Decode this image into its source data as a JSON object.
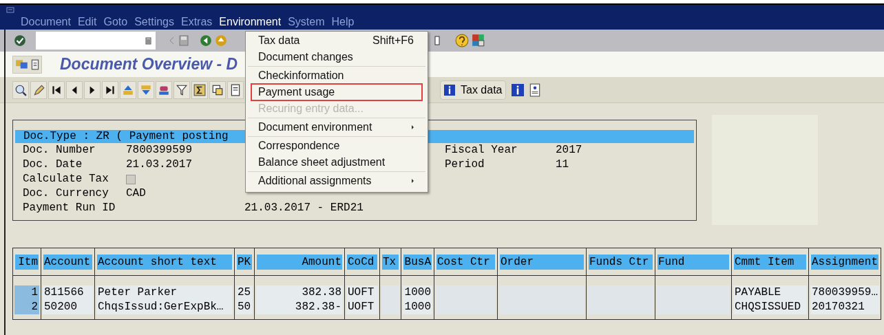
{
  "menu_bar": [
    {
      "label": "Document",
      "selected": false
    },
    {
      "label": "Edit",
      "selected": false
    },
    {
      "label": "Goto",
      "selected": false
    },
    {
      "label": "Settings",
      "selected": false
    },
    {
      "label": "Extras",
      "selected": false
    },
    {
      "label": "Environment",
      "selected": true
    },
    {
      "label": "System",
      "selected": false
    },
    {
      "label": "Help",
      "selected": false
    }
  ],
  "screen_title": "Document Overview - D",
  "app_toolbar": {
    "text_button": "Tax data"
  },
  "dropdown": [
    {
      "kind": "item",
      "label": "Tax data",
      "shortcut": "Shift+F6",
      "disabled": false,
      "submenu": false,
      "marked": false
    },
    {
      "kind": "item",
      "label": "Document changes",
      "disabled": false,
      "submenu": false,
      "marked": false
    },
    {
      "kind": "separator"
    },
    {
      "kind": "item",
      "label": "Checkinformation",
      "disabled": false,
      "submenu": false,
      "marked": false
    },
    {
      "kind": "item",
      "label": "Payment usage",
      "disabled": false,
      "submenu": false,
      "marked": true
    },
    {
      "kind": "item",
      "label": "Recuring entry data...",
      "disabled": true,
      "submenu": false,
      "marked": false
    },
    {
      "kind": "separator"
    },
    {
      "kind": "item",
      "label": "Document environment",
      "disabled": false,
      "submenu": true,
      "marked": false
    },
    {
      "kind": "separator"
    },
    {
      "kind": "item",
      "label": "Correspondence",
      "disabled": false,
      "submenu": false,
      "marked": false
    },
    {
      "kind": "item",
      "label": "Balance sheet adjustment",
      "disabled": false,
      "submenu": false,
      "marked": false
    },
    {
      "kind": "separator"
    },
    {
      "kind": "item",
      "label": "Additional assignments",
      "disabled": false,
      "submenu": true,
      "marked": false
    }
  ],
  "header": {
    "doc_type": "Doc.Type : ZR ( Payment posting",
    "fields": [
      {
        "kind": "text",
        "label": "Doc. Number",
        "value": "7800399599"
      },
      {
        "kind": "text",
        "label": "Doc. Date",
        "value": "21.03.2017"
      },
      {
        "kind": "checkbox",
        "label": "Calculate Tax",
        "checked": false
      },
      {
        "kind": "text",
        "label": "Doc. Currency",
        "value": "CAD"
      },
      {
        "kind": "text",
        "label": "Payment Run ID",
        "value": "21.03.2017 - ERD21"
      }
    ],
    "right_fields": [
      {
        "label": "Fiscal Year",
        "value": "2017"
      },
      {
        "label": "Period",
        "value": "11"
      }
    ]
  },
  "table": {
    "columns": [
      "Itm",
      "Account",
      "Account short text",
      "PK",
      "Amount",
      "CoCd",
      "Tx",
      "BusA",
      "Cost Ctr",
      "Order",
      "Funds Ctr",
      "Fund",
      "Cmmt Item",
      "Assignment"
    ],
    "rows": [
      [
        "1",
        "811566",
        "Peter Parker",
        "25",
        "382.38",
        "UOFT",
        null,
        "1000",
        null,
        null,
        null,
        null,
        "PAYABLE",
        "780039959…"
      ],
      [
        "2",
        "50200",
        "ChqsIssud:GerExpBk…",
        "50",
        "382.38-",
        "UOFT",
        null,
        "1000",
        null,
        null,
        null,
        null,
        "CHQSISSUED",
        "20170321"
      ]
    ]
  }
}
